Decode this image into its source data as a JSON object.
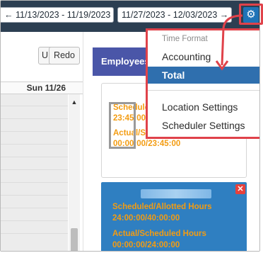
{
  "toolbar": {
    "prev_week_label": "← 11/13/2023 - 11/19/2023",
    "next_week_label": "11/27/2023 - 12/03/2023 →",
    "settings_icon": "gear-icon"
  },
  "editor": {
    "undo_label": "Undo",
    "redo_label": "Redo",
    "day_header": "Sun 11/26",
    "scroll_up_icon": "▲"
  },
  "employees": {
    "tab_label": "Employees"
  },
  "shift_card": {
    "scheduled_label": "Scheduled/",
    "scheduled_value": "23:45:00",
    "actual_label": "Actual/S",
    "actual_value": "00:00:00/23:45:00"
  },
  "shift_card_2": {
    "close_icon": "✕",
    "allotted_label": "Scheduled/Allotted Hours",
    "allotted_value": "24:00:00/40:00:00",
    "actual_label": "Actual/Scheduled Hours",
    "actual_value": "00:00:00/24:00:00"
  },
  "settings_menu": {
    "header": "Time Format",
    "items": [
      {
        "label": "Accounting",
        "active": false
      },
      {
        "label": "Total",
        "active": true
      },
      {
        "label": "Location Settings",
        "active": false
      },
      {
        "label": "Scheduler Settings",
        "active": false
      }
    ]
  },
  "colors": {
    "topbar": "#2c3f52",
    "accent": "#2f6fae",
    "highlight": "#e0424a",
    "orange": "#f39c12"
  }
}
